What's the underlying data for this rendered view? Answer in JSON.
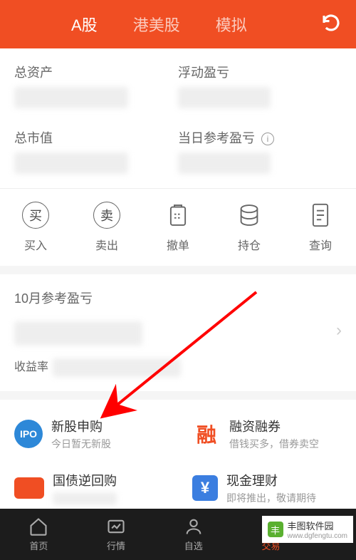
{
  "header": {
    "tabs": [
      "A股",
      "港美股",
      "模拟"
    ],
    "active_index": 0
  },
  "asset": {
    "total_label": "总资产",
    "floating_label": "浮动盈亏",
    "market_value_label": "总市值",
    "daily_ref_label": "当日参考盈亏"
  },
  "actions": {
    "buy": "买入",
    "sell": "卖出",
    "cancel": "撤单",
    "position": "持仓",
    "query": "查询"
  },
  "monthly": {
    "label": "10月参考盈亏",
    "yield_label": "收益率"
  },
  "features": {
    "ipo": {
      "icon": "IPO",
      "title": "新股申购",
      "sub": "今日暂无新股"
    },
    "margin": {
      "icon": "融",
      "title": "融资融券",
      "sub": "借钱买多，借券卖空"
    },
    "bond": {
      "title": "国债逆回购",
      "sub": ""
    },
    "cash": {
      "icon": "¥",
      "title": "现金理财",
      "sub": "即将推出，敬请期待"
    }
  },
  "nav": {
    "home": "首页",
    "market": "行情",
    "optional": "自选",
    "trade": "交易"
  },
  "watermark": {
    "title": "丰图软件园",
    "url": "www.dgfengtu.com"
  }
}
